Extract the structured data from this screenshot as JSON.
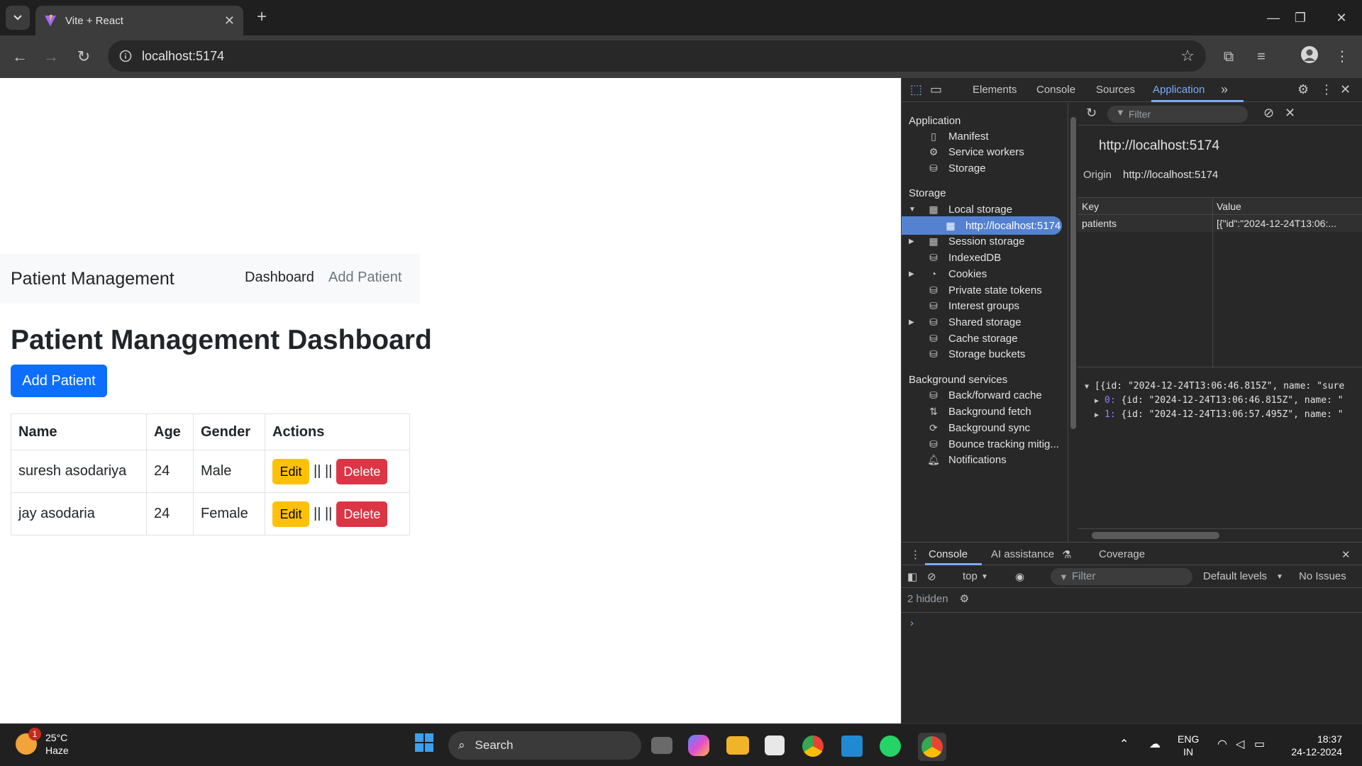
{
  "browser": {
    "tab_title": "Vite + React",
    "tab_close": "✕",
    "new_tab": "+",
    "url": "localhost:5174",
    "window_controls": {
      "minimize": "—",
      "restore": "❐",
      "close": "✕"
    }
  },
  "app": {
    "brand": "Patient Management",
    "nav": {
      "dashboard": "Dashboard",
      "add_patient": "Add Patient"
    },
    "title": "Patient Management Dashboard",
    "add_button": "Add Patient",
    "table": {
      "headers": [
        "Name",
        "Age",
        "Gender",
        "Actions"
      ],
      "rows": [
        {
          "name": "suresh asodariya",
          "age": "24",
          "gender": "Male"
        },
        {
          "name": "jay asodaria",
          "age": "24",
          "gender": "Female"
        }
      ],
      "edit_label": "Edit",
      "separator": "|| ||",
      "delete_label": "Delete"
    }
  },
  "devtools": {
    "tabs": {
      "elements": "Elements",
      "console": "Console",
      "sources": "Sources",
      "application": "Application"
    },
    "sidebar": {
      "application_header": "Application",
      "application_items": [
        "Manifest",
        "Service workers",
        "Storage"
      ],
      "storage_header": "Storage",
      "storage_items": [
        "Local storage",
        "http://localhost:5174",
        "Session storage",
        "IndexedDB",
        "Cookies",
        "Private state tokens",
        "Interest groups",
        "Shared storage",
        "Cache storage",
        "Storage buckets"
      ],
      "background_header": "Background services",
      "background_items": [
        "Back/forward cache",
        "Background fetch",
        "Background sync",
        "Bounce tracking mitig...",
        "Notifications"
      ]
    },
    "local_storage": {
      "filter_placeholder": "Filter",
      "origin_title": "http://localhost:5174",
      "origin_label": "Origin",
      "origin_value": "http://localhost:5174",
      "columns": {
        "key": "Key",
        "value": "Value"
      },
      "entries": [
        {
          "key": "patients",
          "value": "[{\"id\":\"2024-12-24T13:06:..."
        }
      ],
      "preview": {
        "line0": "[{id: \"2024-12-24T13:06:46.815Z\", name: \"sure",
        "line1_idx": "0:",
        "line1": " {id: \"2024-12-24T13:06:46.815Z\", name: \"",
        "line2_idx": "1:",
        "line2": " {id: \"2024-12-24T13:06:57.495Z\", name: \""
      }
    },
    "drawer": {
      "tabs": {
        "console": "Console",
        "ai": "AI assistance",
        "coverage": "Coverage"
      },
      "context": "top",
      "filter_placeholder": "Filter",
      "levels": "Default levels",
      "issues": "No Issues",
      "hidden": "2 hidden",
      "prompt": "›"
    }
  },
  "taskbar": {
    "weather": {
      "temp": "25°C",
      "condition": "Haze",
      "badge": "1"
    },
    "search_label": "Search",
    "language": {
      "line1": "ENG",
      "line2": "IN"
    },
    "clock": {
      "time": "18:37",
      "date": "24-12-2024"
    }
  }
}
